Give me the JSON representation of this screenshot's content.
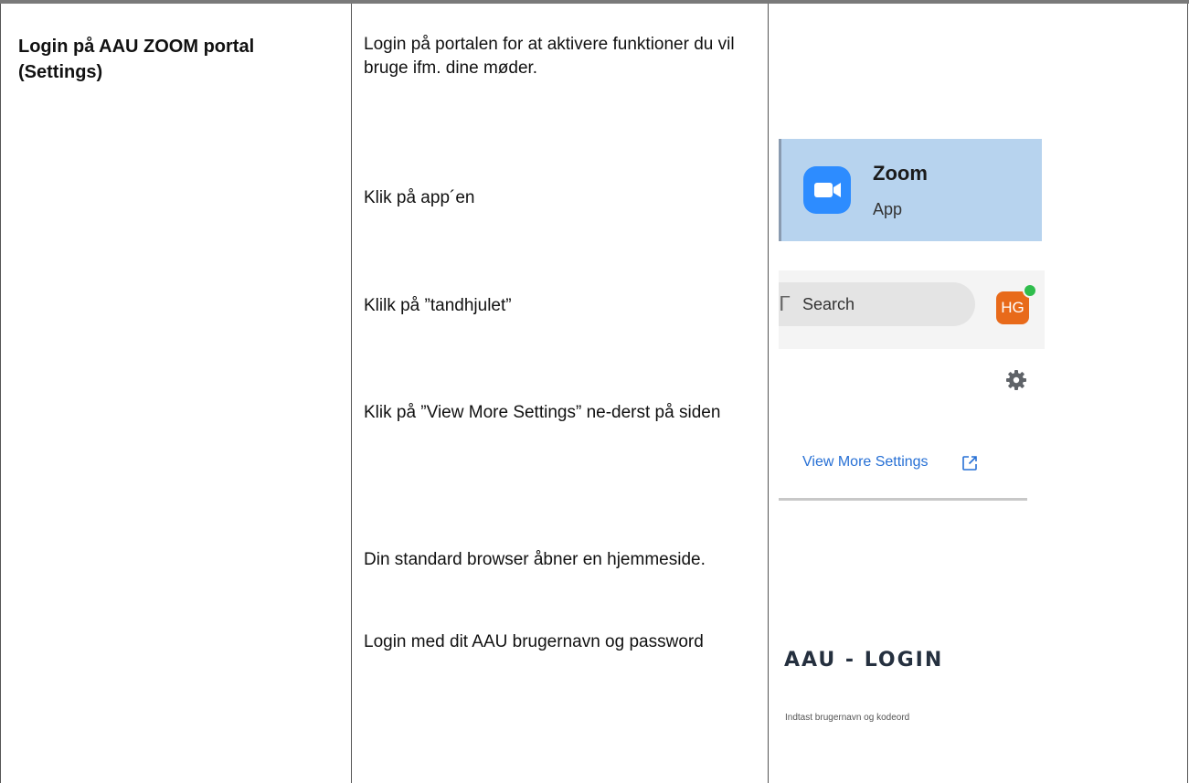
{
  "table": {
    "title": "Login på AAU ZOOM portal (Settings)",
    "intro": "Login på portalen for at aktivere funktioner du vil bruge ifm. dine møder.",
    "steps": [
      "Klik på app´en",
      "Klilk på ”tandhjulet”",
      "Klik på ”View More Settings” ne-derst på siden",
      "Din standard browser åbner en hjemmeside.",
      "Login med dit AAU brugernavn og password"
    ]
  },
  "zoom_app": {
    "name": "Zoom",
    "subtitle": "App",
    "icon": "zoom-camera-icon",
    "tile_color": "#b7d3ee",
    "icon_color": "#2d8cff"
  },
  "search": {
    "label": "Search",
    "avatar_initials": "HG",
    "avatar_color": "#e86a1a",
    "status_color": "#2fbd4c"
  },
  "settings": {
    "gear_icon": "gear-icon",
    "view_more_label": "View More Settings",
    "link_color": "#2770d5",
    "external_icon": "external-link-icon"
  },
  "aau": {
    "title": "AAU - LOGIN",
    "hint": "Indtast brugernavn og kodeord"
  }
}
